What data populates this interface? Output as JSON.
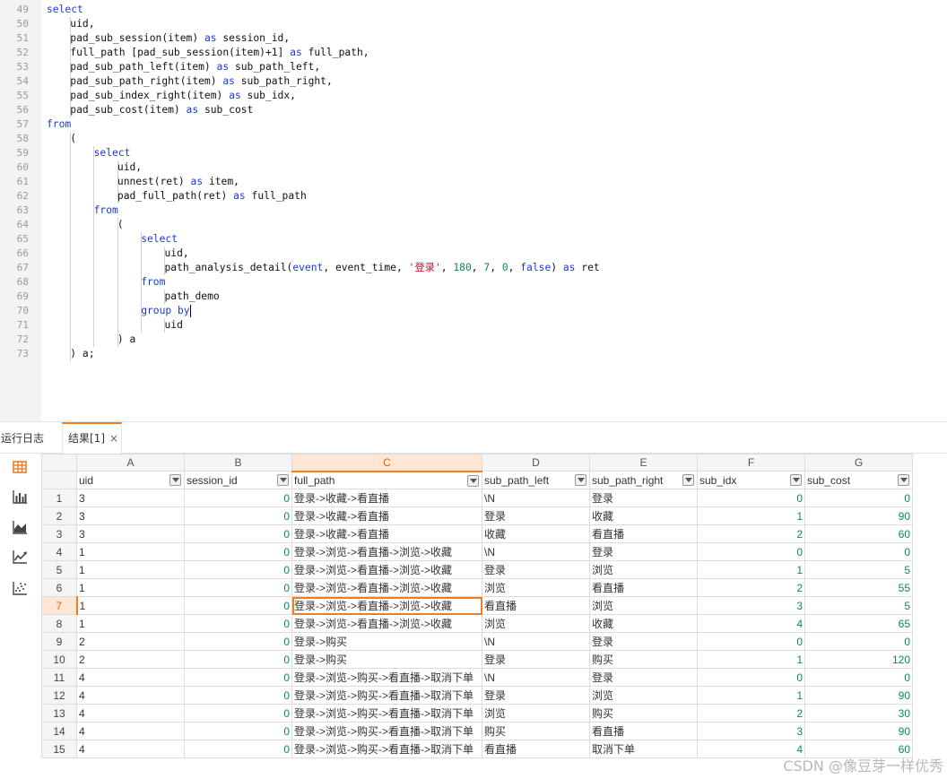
{
  "editor": {
    "line_numbers": [
      "49",
      "50",
      "51",
      "52",
      "53",
      "54",
      "55",
      "56",
      "57",
      "58",
      "59",
      "60",
      "61",
      "62",
      "63",
      "64",
      "65",
      "66",
      "67",
      "68",
      "69",
      "70",
      "71",
      "72",
      "73"
    ],
    "lines": [
      {
        "indent": 0,
        "parts": [
          {
            "t": "select",
            "c": "kw"
          }
        ]
      },
      {
        "indent": 1,
        "parts": [
          {
            "t": "uid,",
            "c": ""
          }
        ]
      },
      {
        "indent": 1,
        "parts": [
          {
            "t": "pad_sub_session(item) ",
            "c": ""
          },
          {
            "t": "as",
            "c": "kw"
          },
          {
            "t": " session_id,",
            "c": ""
          }
        ]
      },
      {
        "indent": 1,
        "parts": [
          {
            "t": "full_path [pad_sub_session(item)+1] ",
            "c": ""
          },
          {
            "t": "as",
            "c": "kw"
          },
          {
            "t": " full_path,",
            "c": ""
          }
        ]
      },
      {
        "indent": 1,
        "parts": [
          {
            "t": "pad_sub_path_left(item) ",
            "c": ""
          },
          {
            "t": "as",
            "c": "kw"
          },
          {
            "t": " sub_path_left,",
            "c": ""
          }
        ]
      },
      {
        "indent": 1,
        "parts": [
          {
            "t": "pad_sub_path_right(item) ",
            "c": ""
          },
          {
            "t": "as",
            "c": "kw"
          },
          {
            "t": " sub_path_right,",
            "c": ""
          }
        ]
      },
      {
        "indent": 1,
        "parts": [
          {
            "t": "pad_sub_index_right(item) ",
            "c": ""
          },
          {
            "t": "as",
            "c": "kw"
          },
          {
            "t": " sub_idx,",
            "c": ""
          }
        ]
      },
      {
        "indent": 1,
        "parts": [
          {
            "t": "pad_sub_cost(item) ",
            "c": ""
          },
          {
            "t": "as",
            "c": "kw"
          },
          {
            "t": " sub_cost",
            "c": ""
          }
        ]
      },
      {
        "indent": 0,
        "parts": [
          {
            "t": "from",
            "c": "kw"
          }
        ]
      },
      {
        "indent": 1,
        "parts": [
          {
            "t": "(",
            "c": ""
          }
        ]
      },
      {
        "indent": 2,
        "parts": [
          {
            "t": "select",
            "c": "kw"
          }
        ]
      },
      {
        "indent": 3,
        "parts": [
          {
            "t": "uid,",
            "c": ""
          }
        ]
      },
      {
        "indent": 3,
        "parts": [
          {
            "t": "unnest(ret) ",
            "c": ""
          },
          {
            "t": "as",
            "c": "kw"
          },
          {
            "t": " item,",
            "c": ""
          }
        ]
      },
      {
        "indent": 3,
        "parts": [
          {
            "t": "pad_full_path(ret) ",
            "c": ""
          },
          {
            "t": "as",
            "c": "kw"
          },
          {
            "t": " full_path",
            "c": ""
          }
        ]
      },
      {
        "indent": 2,
        "parts": [
          {
            "t": "from",
            "c": "kw"
          }
        ]
      },
      {
        "indent": 3,
        "parts": [
          {
            "t": "(",
            "c": ""
          }
        ]
      },
      {
        "indent": 4,
        "parts": [
          {
            "t": "select",
            "c": "kw"
          }
        ]
      },
      {
        "indent": 5,
        "parts": [
          {
            "t": "uid,",
            "c": ""
          }
        ]
      },
      {
        "indent": 5,
        "parts": [
          {
            "t": "path_analysis_detail(",
            "c": ""
          },
          {
            "t": "event",
            "c": "kw"
          },
          {
            "t": ", event_time, ",
            "c": ""
          },
          {
            "t": "'登录'",
            "c": "str"
          },
          {
            "t": ", ",
            "c": ""
          },
          {
            "t": "180",
            "c": "num"
          },
          {
            "t": ", ",
            "c": ""
          },
          {
            "t": "7",
            "c": "num"
          },
          {
            "t": ", ",
            "c": ""
          },
          {
            "t": "0",
            "c": "num"
          },
          {
            "t": ", ",
            "c": ""
          },
          {
            "t": "false",
            "c": "kw"
          },
          {
            "t": ") ",
            "c": ""
          },
          {
            "t": "as",
            "c": "kw"
          },
          {
            "t": " ret",
            "c": ""
          }
        ]
      },
      {
        "indent": 4,
        "parts": [
          {
            "t": "from",
            "c": "kw"
          }
        ]
      },
      {
        "indent": 5,
        "parts": [
          {
            "t": "path_demo",
            "c": ""
          }
        ]
      },
      {
        "indent": 4,
        "parts": [
          {
            "t": "group by",
            "c": "kw"
          }
        ],
        "cursor": true
      },
      {
        "indent": 5,
        "parts": [
          {
            "t": "uid",
            "c": ""
          }
        ]
      },
      {
        "indent": 3,
        "parts": [
          {
            "t": ") a",
            "c": ""
          }
        ]
      },
      {
        "indent": 1,
        "parts": [
          {
            "t": ") a;",
            "c": ""
          }
        ]
      }
    ]
  },
  "panel": {
    "log_tab": "运行日志",
    "result_tab": "结果[1]",
    "close_glyph": "×"
  },
  "tools": [
    "table-view-icon",
    "bar-chart-icon",
    "area-chart-icon",
    "line-chart-icon",
    "scatter-chart-icon"
  ],
  "grid": {
    "col_letters": [
      "A",
      "B",
      "C",
      "D",
      "E",
      "F",
      "G"
    ],
    "selected_col": 2,
    "headers": [
      "uid",
      "session_id",
      "full_path",
      "sub_path_left",
      "sub_path_right",
      "sub_idx",
      "sub_cost"
    ],
    "selected_row": 7,
    "rows": [
      [
        "3",
        "0",
        "登录->收藏->看直播",
        "\\N",
        "登录",
        "0",
        "0"
      ],
      [
        "3",
        "0",
        "登录->收藏->看直播",
        "登录",
        "收藏",
        "1",
        "90"
      ],
      [
        "3",
        "0",
        "登录->收藏->看直播",
        "收藏",
        "看直播",
        "2",
        "60"
      ],
      [
        "1",
        "0",
        "登录->浏览->看直播->浏览->收藏",
        "\\N",
        "登录",
        "0",
        "0"
      ],
      [
        "1",
        "0",
        "登录->浏览->看直播->浏览->收藏",
        "登录",
        "浏览",
        "1",
        "5"
      ],
      [
        "1",
        "0",
        "登录->浏览->看直播->浏览->收藏",
        "浏览",
        "看直播",
        "2",
        "55"
      ],
      [
        "1",
        "0",
        "登录->浏览->看直播->浏览->收藏",
        "看直播",
        "浏览",
        "3",
        "5"
      ],
      [
        "1",
        "0",
        "登录->浏览->看直播->浏览->收藏",
        "浏览",
        "收藏",
        "4",
        "65"
      ],
      [
        "2",
        "0",
        "登录->购买",
        "\\N",
        "登录",
        "0",
        "0"
      ],
      [
        "2",
        "0",
        "登录->购买",
        "登录",
        "购买",
        "1",
        "120"
      ],
      [
        "4",
        "0",
        "登录->浏览->购买->看直播->取消下单",
        "\\N",
        "登录",
        "0",
        "0"
      ],
      [
        "4",
        "0",
        "登录->浏览->购买->看直播->取消下单",
        "登录",
        "浏览",
        "1",
        "90"
      ],
      [
        "4",
        "0",
        "登录->浏览->购买->看直播->取消下单",
        "浏览",
        "购买",
        "2",
        "30"
      ],
      [
        "4",
        "0",
        "登录->浏览->购买->看直播->取消下单",
        "购买",
        "看直播",
        "3",
        "90"
      ],
      [
        "4",
        "0",
        "登录->浏览->购买->看直播->取消下单",
        "看直播",
        "取消下单",
        "4",
        "60"
      ]
    ]
  },
  "watermark": "CSDN @像豆芽一样优秀",
  "colors": {
    "accent": "#f07d22",
    "keyword": "#1a3cc8",
    "string": "#c8102e",
    "number": "#0a8a5a"
  }
}
